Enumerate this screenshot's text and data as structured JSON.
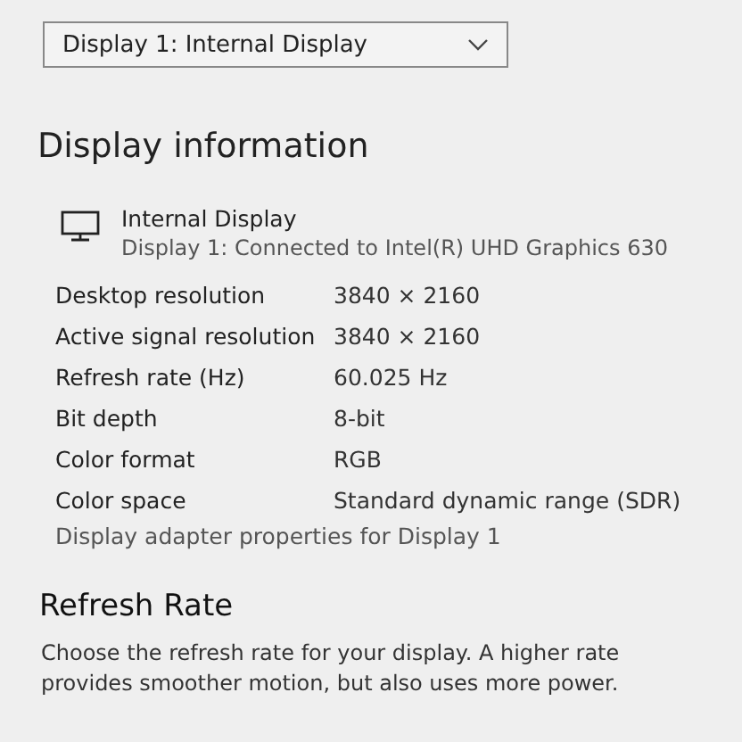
{
  "display_select": {
    "value": "Display 1: Internal Display"
  },
  "display_information": {
    "title": "Display information",
    "display_name": "Internal Display",
    "connection": "Display 1: Connected to Intel(R) UHD Graphics 630",
    "rows": [
      {
        "label": "Desktop resolution",
        "value": "3840 × 2160"
      },
      {
        "label": "Active signal resolution",
        "value": "3840 × 2160"
      },
      {
        "label": "Refresh rate (Hz)",
        "value": "60.025 Hz"
      },
      {
        "label": "Bit depth",
        "value": "8-bit"
      },
      {
        "label": "Color format",
        "value": "RGB"
      },
      {
        "label": "Color space",
        "value": "Standard dynamic range (SDR)"
      }
    ],
    "link": "Display adapter properties for Display 1"
  },
  "refresh_rate": {
    "title": "Refresh Rate",
    "description": "Choose the refresh rate for your display. A higher rate provides smoother motion, but also uses more power."
  }
}
